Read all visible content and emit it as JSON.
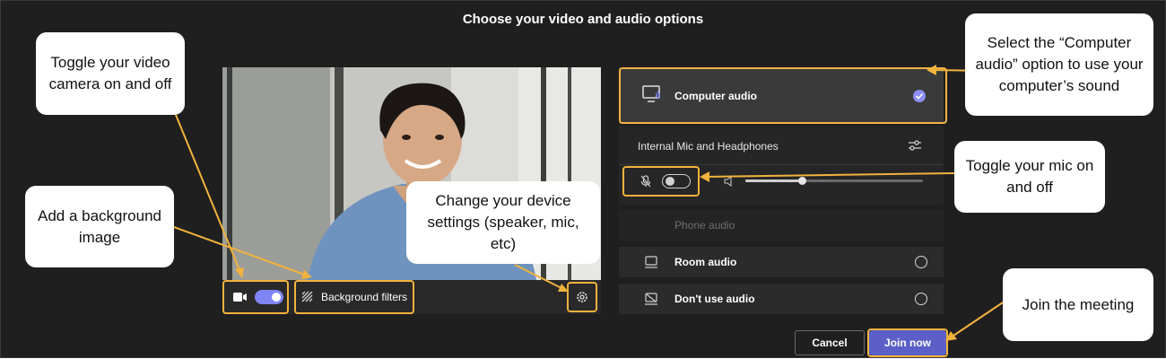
{
  "header": {
    "title": "Choose your video and audio options"
  },
  "video": {
    "camera_toggle_on": true,
    "background_filters_label": "Background filters"
  },
  "audio": {
    "computer_audio_label": "Computer audio",
    "device_label": "Internal Mic and Headphones",
    "mic_toggle_on": false,
    "volume_fraction": 0.32,
    "phone_audio_label": "Phone audio",
    "room_audio_label": "Room audio",
    "no_audio_label": "Don't use audio"
  },
  "actions": {
    "cancel_label": "Cancel",
    "join_label": "Join now"
  },
  "callouts": {
    "camera": "Toggle your video camera on and off",
    "background": "Add a background image",
    "settings": "Change your device settings (speaker, mic, etc)",
    "computer_audio": "Select the “Computer audio” option to use your computer’s sound",
    "mic": "Toggle your mic on and off",
    "join": "Join the meeting"
  },
  "colors": {
    "highlight": "#f2b33d",
    "accent": "#7f85f5",
    "primary_button": "#5b5fc7",
    "background": "#1f1f1f"
  }
}
